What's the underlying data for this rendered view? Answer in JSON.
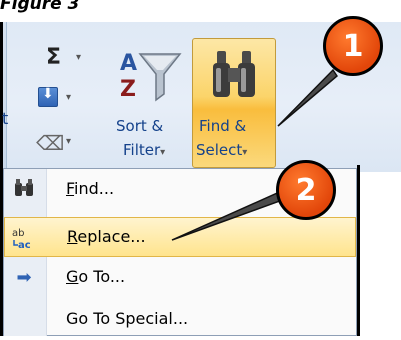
{
  "figure": {
    "caption": "Figure 3"
  },
  "ribbon": {
    "left_cut_letter": "t",
    "editing": {
      "sort_filter": {
        "line1": "Sort &",
        "line2": "Filter",
        "dropdown": "▾"
      },
      "find_select": {
        "line1": "Find &",
        "line2": "Select",
        "dropdown": "▾"
      },
      "sum_dropdown": "▾",
      "fill_dropdown": "▾",
      "clear_dropdown": "▾"
    }
  },
  "menu": {
    "items": [
      {
        "label_ul": "F",
        "label_rest": "ind...",
        "icon": "binoculars-icon"
      },
      {
        "label_ul": "R",
        "label_rest": "eplace...",
        "icon": "replace-icon"
      },
      {
        "label_ul": "G",
        "label_rest": "o To...",
        "icon": "arrow-right-icon"
      },
      {
        "label_ul": "",
        "label_rest": "Go To Special...",
        "icon": ""
      }
    ]
  },
  "callouts": {
    "one": "1",
    "two": "2"
  },
  "colors": {
    "ribbon_text": "#15428b",
    "highlight_orange": "#f9bd3d",
    "callout_orange": "#e2460a"
  }
}
